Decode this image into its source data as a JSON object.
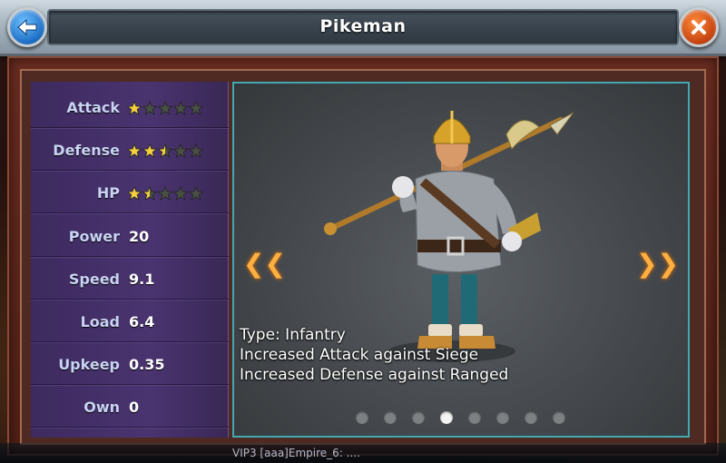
{
  "header": {
    "title": "Pikeman"
  },
  "stats": [
    {
      "label": "Attack",
      "stars": 1,
      "max_stars": 5
    },
    {
      "label": "Defense",
      "stars": 2.5,
      "max_stars": 5
    },
    {
      "label": "HP",
      "stars": 1.5,
      "max_stars": 5
    },
    {
      "label": "Power",
      "value": "20"
    },
    {
      "label": "Speed",
      "value": "9.1"
    },
    {
      "label": "Load",
      "value": "6.4"
    },
    {
      "label": "Upkeep",
      "value": "0.35"
    },
    {
      "label": "Own",
      "value": "0"
    }
  ],
  "unit": {
    "type_line": "Type: Infantry",
    "bonus_1": "Increased Attack against Siege",
    "bonus_2": "Increased Defense against Ranged"
  },
  "pager": {
    "total": 8,
    "active_index": 3
  },
  "chat": {
    "text": "VIP3 [aaa]Empire_6: ...."
  },
  "colors": {
    "star_filled": "#f4d03f",
    "star_empty": "#4a4f45",
    "accent_border": "#3fa9b4",
    "arrow": "#ffb040"
  }
}
